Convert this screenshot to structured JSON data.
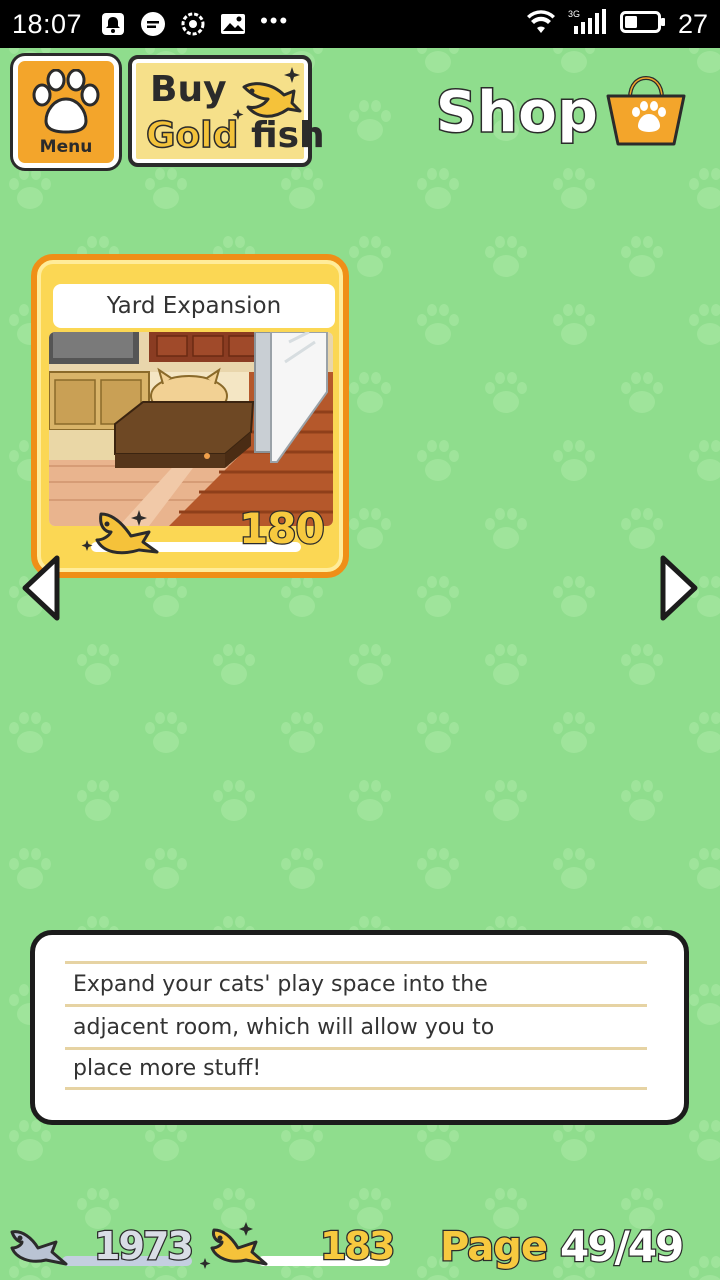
{
  "status_bar": {
    "time": "18:07",
    "battery_level": "27",
    "network_label": "3G",
    "icons": [
      "notification-icon",
      "chat-icon",
      "settings-icon",
      "image-icon",
      "more-dots-icon",
      "wifi-icon",
      "signal-icon",
      "battery-icon"
    ]
  },
  "header": {
    "menu_label": "Menu",
    "buy_line1": "Buy",
    "buy_gold_word": "Gold",
    "buy_fish_word": "fish",
    "title": "Shop"
  },
  "item": {
    "name": "Yard Expansion",
    "price": "180",
    "currency": "gold-fish"
  },
  "description": {
    "lines": [
      "Expand your cats' play space into the",
      "adjacent room, which will allow you to",
      "place more stuff!"
    ]
  },
  "footer": {
    "silver_fish_count": "1973",
    "gold_fish_count": "183",
    "page_label": "Page",
    "page_number": "49/49"
  },
  "colors": {
    "background": "#8fdd8d",
    "card_border": "#ef8f17",
    "card_fill": "#fbd754",
    "gold_text": "#f7c93f",
    "outline": "#2b2b2b"
  }
}
